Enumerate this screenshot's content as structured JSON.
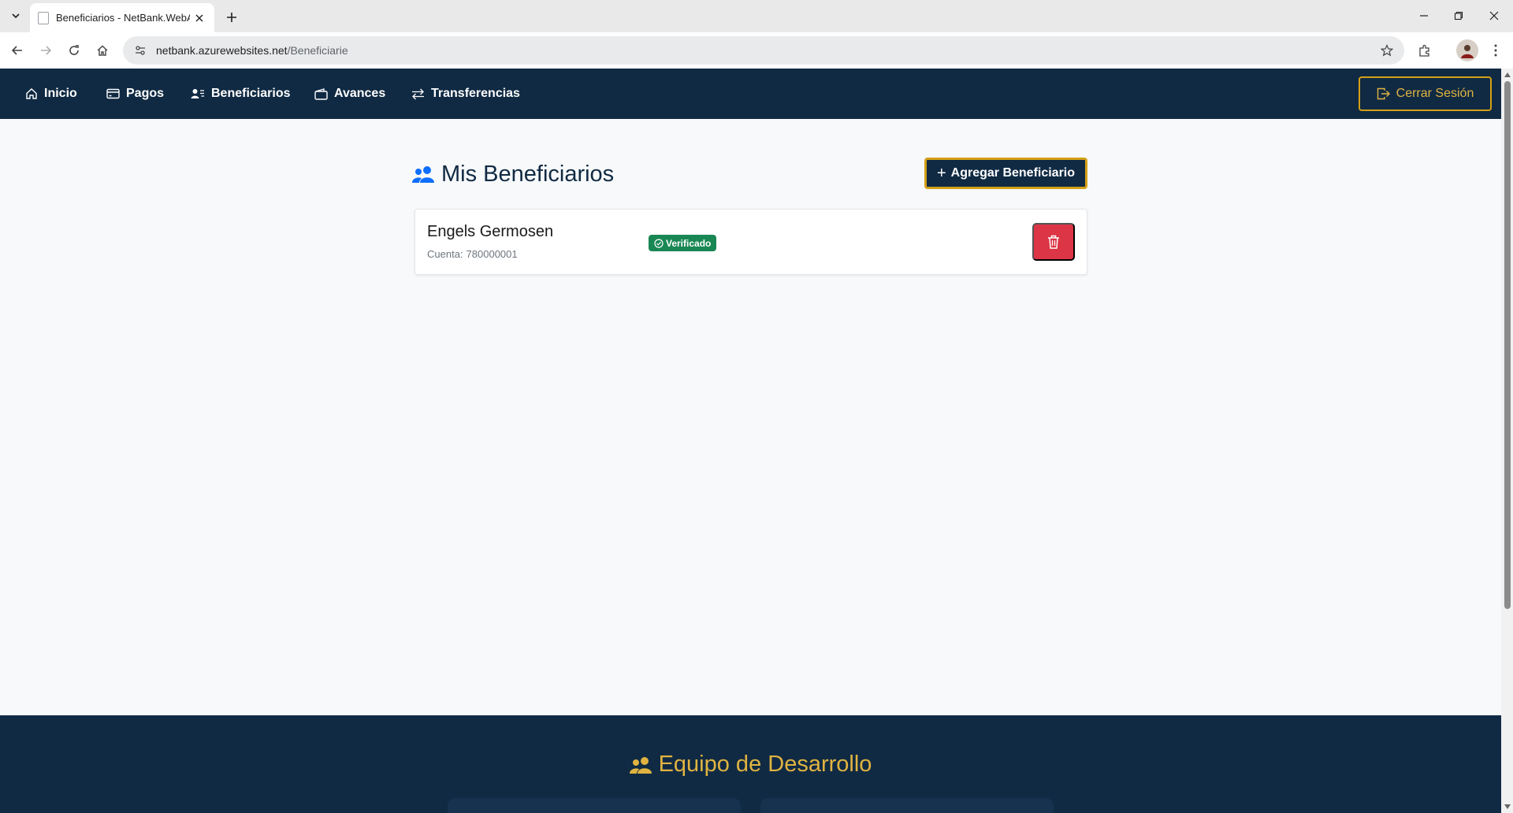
{
  "browser": {
    "tab_title": "Beneficiarios - NetBank.WebApp",
    "url_host": "netbank.azurewebsites.net",
    "url_path": "/Beneficiarie"
  },
  "nav": {
    "items": [
      {
        "label": "Inicio",
        "icon": "house-icon"
      },
      {
        "label": "Pagos",
        "icon": "credit-card-icon"
      },
      {
        "label": "Beneficiarios",
        "icon": "person-lines-icon"
      },
      {
        "label": "Avances",
        "icon": "wallet-icon"
      },
      {
        "label": "Transferencias",
        "icon": "arrow-left-right-icon"
      }
    ],
    "logout_label": "Cerrar Sesión"
  },
  "main": {
    "title": "Mis Beneficiarios",
    "add_button_label": "Agregar Beneficiario",
    "beneficiaries": [
      {
        "name": "Engels Germosen",
        "account_label": "Cuenta:",
        "account_number": "780000001",
        "status": "Verificado"
      }
    ]
  },
  "footer": {
    "title": "Equipo de Desarrollo"
  },
  "colors": {
    "navbar": "#102a43",
    "accent_gold": "#d4a017",
    "success": "#198754",
    "danger": "#dc3545",
    "title_icon": "#0d6efd"
  }
}
